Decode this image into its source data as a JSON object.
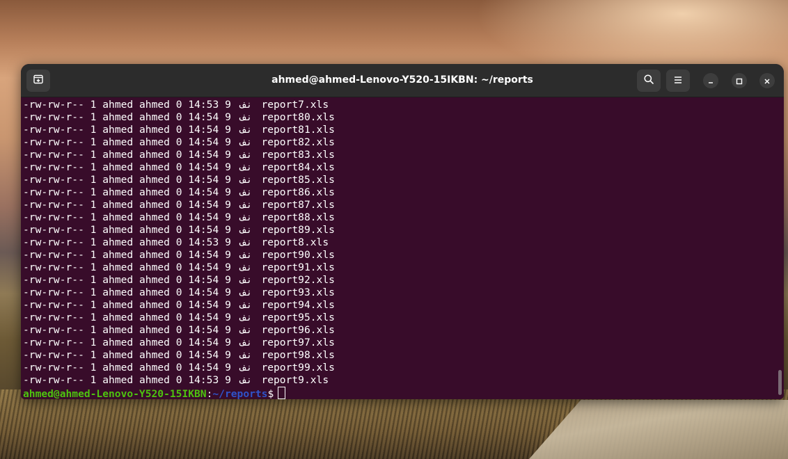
{
  "window": {
    "title": "ahmed@ahmed-Lenovo-Y520-15IKBN: ~/reports"
  },
  "icons": {
    "new_tab": "new-tab-icon",
    "search": "search-icon",
    "menu": "hamburger-menu-icon",
    "minimize": "minimize-icon",
    "maximize": "maximize-icon",
    "close": "close-icon"
  },
  "colors": {
    "terminal_bg": "#380c2a",
    "titlebar_bg": "#2c2c2c",
    "prompt_user": "#4ec30f",
    "prompt_path": "#2f53c9"
  },
  "listing": [
    {
      "perms": "-rw-rw-r--",
      "links": "1",
      "owner": "ahmed",
      "group": "ahmed",
      "size": "0",
      "time": "14:53",
      "day": "9",
      "month": "نف",
      "name": "report7.xls"
    },
    {
      "perms": "-rw-rw-r--",
      "links": "1",
      "owner": "ahmed",
      "group": "ahmed",
      "size": "0",
      "time": "14:54",
      "day": "9",
      "month": "نف",
      "name": "report80.xls"
    },
    {
      "perms": "-rw-rw-r--",
      "links": "1",
      "owner": "ahmed",
      "group": "ahmed",
      "size": "0",
      "time": "14:54",
      "day": "9",
      "month": "نف",
      "name": "report81.xls"
    },
    {
      "perms": "-rw-rw-r--",
      "links": "1",
      "owner": "ahmed",
      "group": "ahmed",
      "size": "0",
      "time": "14:54",
      "day": "9",
      "month": "نف",
      "name": "report82.xls"
    },
    {
      "perms": "-rw-rw-r--",
      "links": "1",
      "owner": "ahmed",
      "group": "ahmed",
      "size": "0",
      "time": "14:54",
      "day": "9",
      "month": "نف",
      "name": "report83.xls"
    },
    {
      "perms": "-rw-rw-r--",
      "links": "1",
      "owner": "ahmed",
      "group": "ahmed",
      "size": "0",
      "time": "14:54",
      "day": "9",
      "month": "نف",
      "name": "report84.xls"
    },
    {
      "perms": "-rw-rw-r--",
      "links": "1",
      "owner": "ahmed",
      "group": "ahmed",
      "size": "0",
      "time": "14:54",
      "day": "9",
      "month": "نف",
      "name": "report85.xls"
    },
    {
      "perms": "-rw-rw-r--",
      "links": "1",
      "owner": "ahmed",
      "group": "ahmed",
      "size": "0",
      "time": "14:54",
      "day": "9",
      "month": "نف",
      "name": "report86.xls"
    },
    {
      "perms": "-rw-rw-r--",
      "links": "1",
      "owner": "ahmed",
      "group": "ahmed",
      "size": "0",
      "time": "14:54",
      "day": "9",
      "month": "نف",
      "name": "report87.xls"
    },
    {
      "perms": "-rw-rw-r--",
      "links": "1",
      "owner": "ahmed",
      "group": "ahmed",
      "size": "0",
      "time": "14:54",
      "day": "9",
      "month": "نف",
      "name": "report88.xls"
    },
    {
      "perms": "-rw-rw-r--",
      "links": "1",
      "owner": "ahmed",
      "group": "ahmed",
      "size": "0",
      "time": "14:54",
      "day": "9",
      "month": "نف",
      "name": "report89.xls"
    },
    {
      "perms": "-rw-rw-r--",
      "links": "1",
      "owner": "ahmed",
      "group": "ahmed",
      "size": "0",
      "time": "14:53",
      "day": "9",
      "month": "نف",
      "name": "report8.xls"
    },
    {
      "perms": "-rw-rw-r--",
      "links": "1",
      "owner": "ahmed",
      "group": "ahmed",
      "size": "0",
      "time": "14:54",
      "day": "9",
      "month": "نف",
      "name": "report90.xls"
    },
    {
      "perms": "-rw-rw-r--",
      "links": "1",
      "owner": "ahmed",
      "group": "ahmed",
      "size": "0",
      "time": "14:54",
      "day": "9",
      "month": "نف",
      "name": "report91.xls"
    },
    {
      "perms": "-rw-rw-r--",
      "links": "1",
      "owner": "ahmed",
      "group": "ahmed",
      "size": "0",
      "time": "14:54",
      "day": "9",
      "month": "نف",
      "name": "report92.xls"
    },
    {
      "perms": "-rw-rw-r--",
      "links": "1",
      "owner": "ahmed",
      "group": "ahmed",
      "size": "0",
      "time": "14:54",
      "day": "9",
      "month": "نف",
      "name": "report93.xls"
    },
    {
      "perms": "-rw-rw-r--",
      "links": "1",
      "owner": "ahmed",
      "group": "ahmed",
      "size": "0",
      "time": "14:54",
      "day": "9",
      "month": "نف",
      "name": "report94.xls"
    },
    {
      "perms": "-rw-rw-r--",
      "links": "1",
      "owner": "ahmed",
      "group": "ahmed",
      "size": "0",
      "time": "14:54",
      "day": "9",
      "month": "نف",
      "name": "report95.xls"
    },
    {
      "perms": "-rw-rw-r--",
      "links": "1",
      "owner": "ahmed",
      "group": "ahmed",
      "size": "0",
      "time": "14:54",
      "day": "9",
      "month": "نف",
      "name": "report96.xls"
    },
    {
      "perms": "-rw-rw-r--",
      "links": "1",
      "owner": "ahmed",
      "group": "ahmed",
      "size": "0",
      "time": "14:54",
      "day": "9",
      "month": "نف",
      "name": "report97.xls"
    },
    {
      "perms": "-rw-rw-r--",
      "links": "1",
      "owner": "ahmed",
      "group": "ahmed",
      "size": "0",
      "time": "14:54",
      "day": "9",
      "month": "نف",
      "name": "report98.xls"
    },
    {
      "perms": "-rw-rw-r--",
      "links": "1",
      "owner": "ahmed",
      "group": "ahmed",
      "size": "0",
      "time": "14:54",
      "day": "9",
      "month": "نف",
      "name": "report99.xls"
    },
    {
      "perms": "-rw-rw-r--",
      "links": "1",
      "owner": "ahmed",
      "group": "ahmed",
      "size": "0",
      "time": "14:53",
      "day": "9",
      "month": "نف",
      "name": "report9.xls"
    }
  ],
  "prompt": {
    "user_host": "ahmed@ahmed-Lenovo-Y520-15IKBN",
    "separator": ":",
    "path": "~/reports",
    "symbol": "$"
  }
}
